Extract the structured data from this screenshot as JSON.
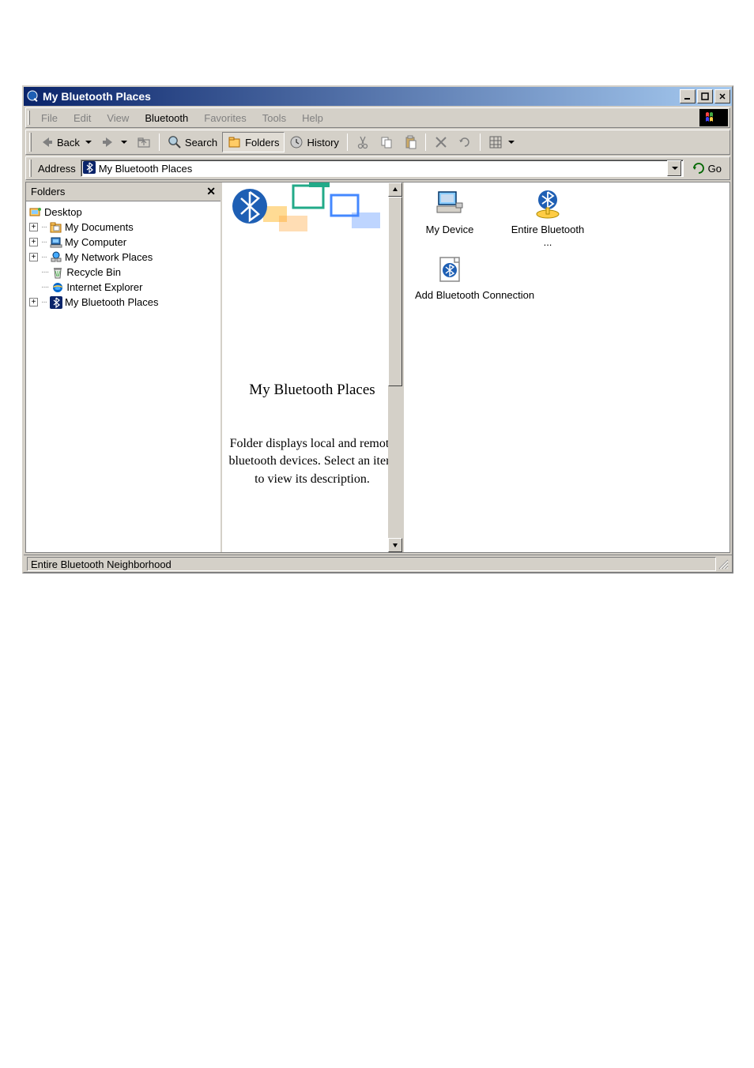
{
  "title": "My Bluetooth Places",
  "menu": {
    "items": [
      {
        "label": "File",
        "enabled": false
      },
      {
        "label": "Edit",
        "enabled": false
      },
      {
        "label": "View",
        "enabled": false
      },
      {
        "label": "Bluetooth",
        "enabled": true
      },
      {
        "label": "Favorites",
        "enabled": false
      },
      {
        "label": "Tools",
        "enabled": false
      },
      {
        "label": "Help",
        "enabled": false
      }
    ]
  },
  "toolbar": {
    "back": "Back",
    "search": "Search",
    "folders": "Folders",
    "history": "History"
  },
  "address": {
    "label": "Address",
    "value": "My Bluetooth Places",
    "go": "Go"
  },
  "foldersPane": {
    "title": "Folders",
    "tree": {
      "root": "Desktop",
      "items": [
        {
          "label": "My Documents",
          "expandable": true
        },
        {
          "label": "My Computer",
          "expandable": true
        },
        {
          "label": "My Network Places",
          "expandable": true
        },
        {
          "label": "Recycle Bin",
          "expandable": false
        },
        {
          "label": "Internet Explorer",
          "expandable": false
        },
        {
          "label": "My Bluetooth Places",
          "expandable": true
        }
      ]
    }
  },
  "info": {
    "title": "My Bluetooth Places",
    "desc1": "Folder displays local and remote bluetooth devices.",
    "desc2": "Select an item to view its description."
  },
  "icons": {
    "items": [
      {
        "label": "My Device"
      },
      {
        "label": "Entire Bluetooth ..."
      },
      {
        "label": "Add Bluetooth Connection"
      }
    ]
  },
  "status": "Entire Bluetooth Neighborhood"
}
